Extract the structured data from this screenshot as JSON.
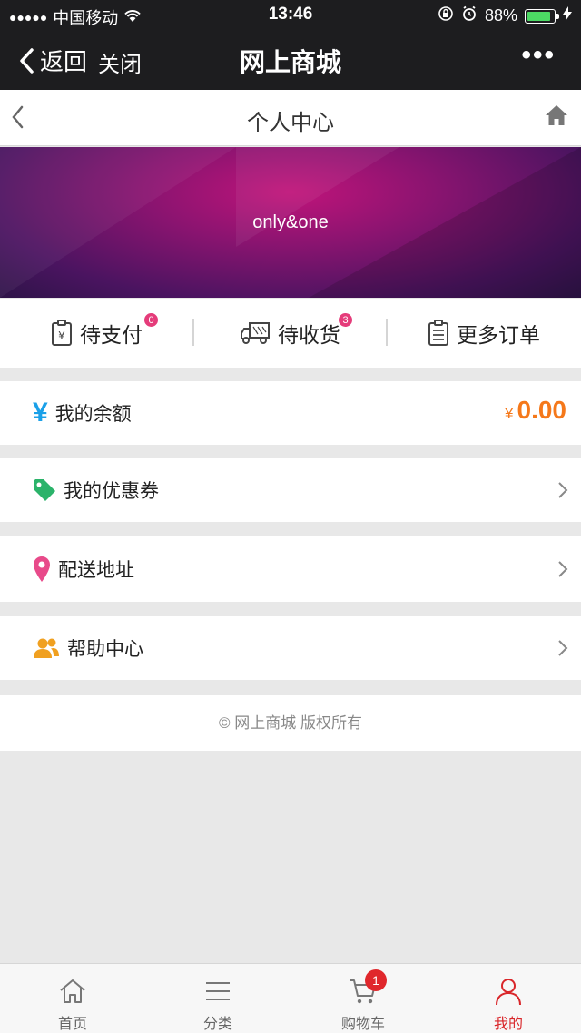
{
  "status_bar": {
    "signal": "●●●●●",
    "carrier": "中国移动",
    "time": "13:46",
    "battery": "88%",
    "battery_level": 0.88
  },
  "wechat_nav": {
    "back_label": "返回",
    "close_label": "关闭",
    "title": "网上商城",
    "more_label": "•••"
  },
  "page_header": {
    "title": "个人中心"
  },
  "banner": {
    "username": "only&one"
  },
  "orders": [
    {
      "label": "待支付",
      "badge": "0"
    },
    {
      "label": "待收货",
      "badge": "3"
    },
    {
      "label": "更多订单"
    }
  ],
  "menu": {
    "balance": {
      "label": "我的余额",
      "currency": "¥",
      "amount": "0.00",
      "icon_text": "¥"
    },
    "coupons": {
      "label": "我的优惠券"
    },
    "address": {
      "label": "配送地址"
    },
    "help": {
      "label": "帮助中心"
    }
  },
  "footer": {
    "copyright": "©  网上商城    版权所有"
  },
  "tabbar": [
    {
      "label": "首页",
      "icon": "home-icon"
    },
    {
      "label": "分类",
      "icon": "list-icon"
    },
    {
      "label": "购物车",
      "icon": "cart-icon",
      "badge": "1"
    },
    {
      "label": "我的",
      "icon": "user-icon",
      "active": true
    }
  ],
  "colors": {
    "accent_orange": "#f5781a",
    "badge_pink": "#e53c7a",
    "active_red": "#d9262a",
    "yen_blue": "#1aa0e8",
    "tag_green": "#2bb36a",
    "pin_pink": "#e84a8a",
    "help_orange": "#f0a020"
  }
}
